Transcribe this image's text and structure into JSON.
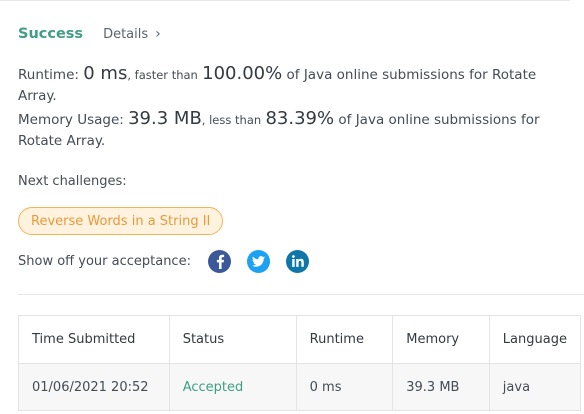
{
  "status": {
    "result": "Success",
    "details_label": "Details",
    "chevron": "›"
  },
  "runtime": {
    "label": "Runtime:",
    "value": "0 ms",
    "comparison": ", faster than",
    "percent": "100.00%",
    "suffix": "of Java online submissions for Rotate Array."
  },
  "memory": {
    "label": "Memory Usage:",
    "value": "39.3 MB",
    "comparison": ", less than",
    "percent": "83.39%",
    "suffix": "of Java online submissions for Rotate Array."
  },
  "next_challenges": {
    "label": "Next challenges:",
    "items": [
      "Reverse Words in a String II"
    ]
  },
  "share": {
    "label": "Show off your acceptance:",
    "icons": [
      "facebook-icon",
      "twitter-icon",
      "linkedin-icon"
    ]
  },
  "submissions": {
    "headers": [
      "Time Submitted",
      "Status",
      "Runtime",
      "Memory",
      "Language"
    ],
    "rows": [
      [
        "01/06/2021 20:52",
        "Accepted",
        "0 ms",
        "39.3 MB",
        "java"
      ]
    ]
  },
  "colors": {
    "success": "#3f9f85",
    "challenge_pill": "#e8993a",
    "facebook": "#3b5998",
    "twitter": "#1da1f2",
    "linkedin": "#0e76a8"
  }
}
